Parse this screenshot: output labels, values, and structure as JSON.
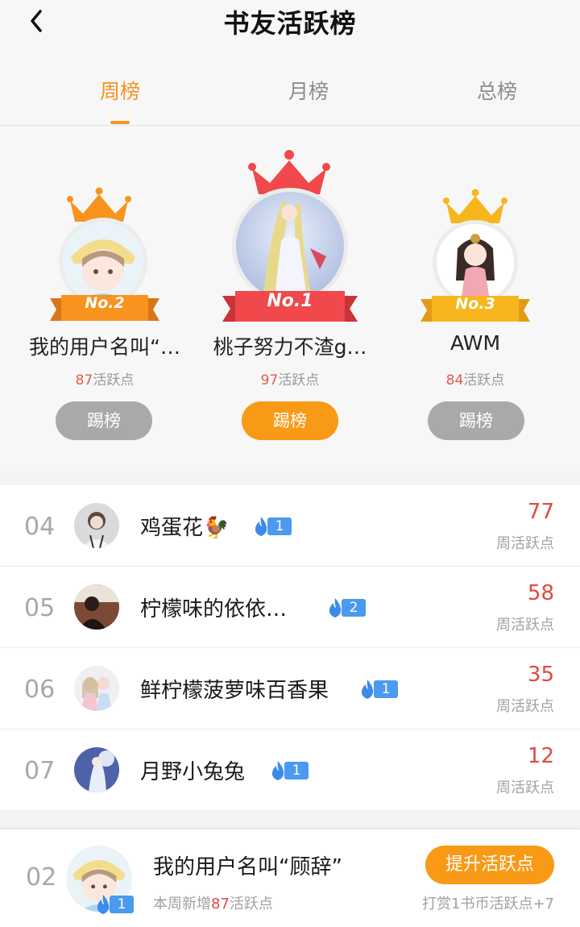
{
  "header": {
    "title": "书友活跃榜",
    "back_icon": "chevron-left-icon"
  },
  "tabs": [
    {
      "label": "周榜",
      "active": true
    },
    {
      "label": "月榜",
      "active": false
    },
    {
      "label": "总榜",
      "active": false
    }
  ],
  "podium": {
    "second": {
      "rank_label": "No.2",
      "name": "我的用户名叫“…",
      "points": "87",
      "points_unit": "活跃点",
      "button": "踢榜"
    },
    "first": {
      "rank_label": "No.1",
      "name": "桃子努力不渣g…",
      "points": "97",
      "points_unit": "活跃点",
      "button": "踢榜"
    },
    "third": {
      "rank_label": "No.3",
      "name": "AWM",
      "points": "84",
      "points_unit": "活跃点",
      "button": "踢榜"
    }
  },
  "list": [
    {
      "rank": "04",
      "name": "鸡蛋花🐓",
      "level": "1",
      "points": "77",
      "points_label": "周活跃点"
    },
    {
      "rank": "05",
      "name": "柠檬味的依依…",
      "level": "2",
      "points": "58",
      "points_label": "周活跃点"
    },
    {
      "rank": "06",
      "name": "鲜柠檬菠萝味百香果",
      "level": "1",
      "points": "35",
      "points_label": "周活跃点"
    },
    {
      "rank": "07",
      "name": "月野小兔兔",
      "level": "1",
      "points": "12",
      "points_label": "周活跃点"
    }
  ],
  "footer": {
    "rank": "02",
    "name": "我的用户名叫“顾辞”",
    "level": "1",
    "week_prefix": "本周新增",
    "week_points": "87",
    "week_suffix": "活跃点",
    "boost_button": "提升活跃点",
    "reward_note": "打赏1书币活跃点+7"
  },
  "colors": {
    "accent": "#f7931e",
    "points_red": "#e0493e",
    "level_blue": "#4a9af0",
    "kick_grey": "#a9a9a9"
  }
}
